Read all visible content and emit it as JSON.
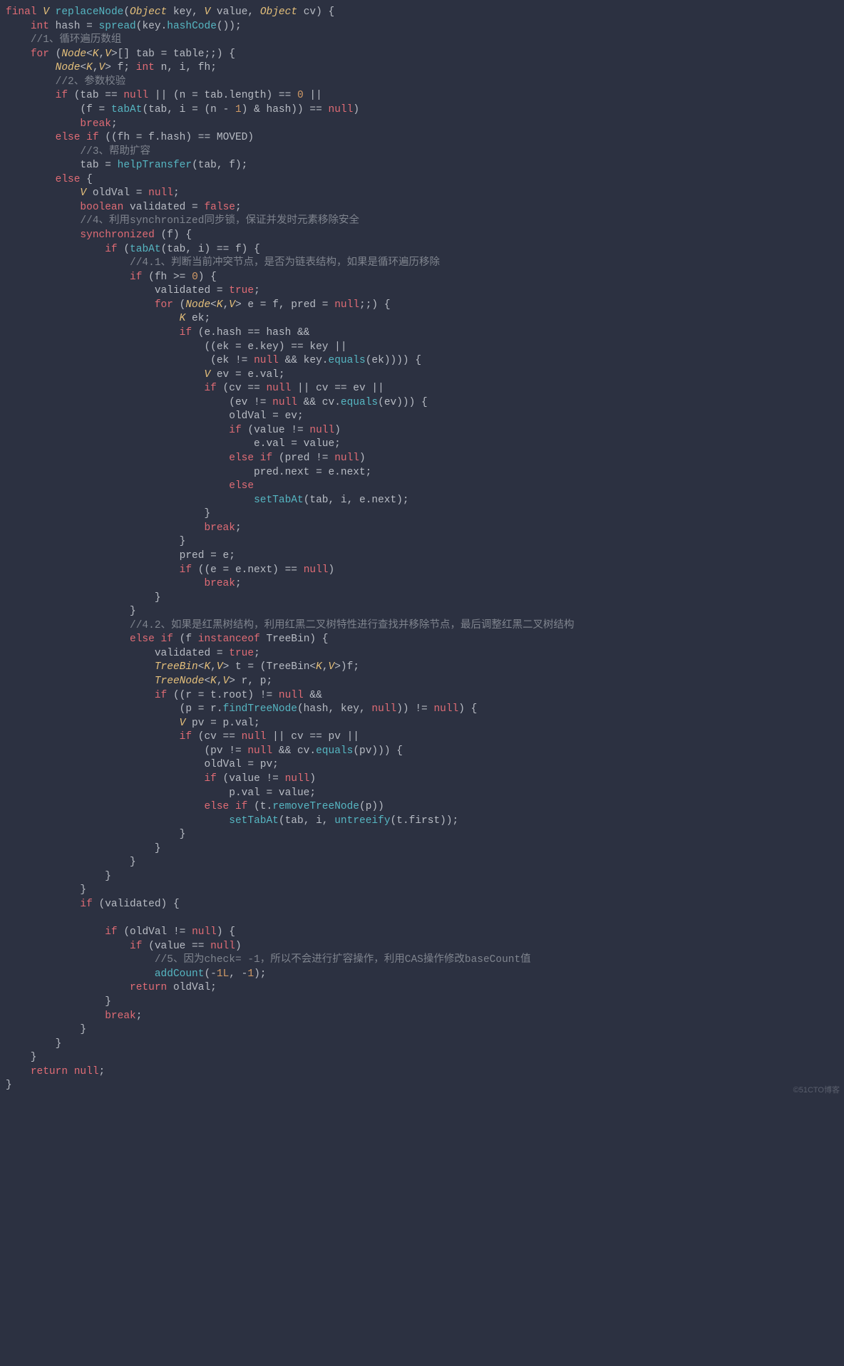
{
  "watermark": "©51CTO博客",
  "code": {
    "tokens": [
      [
        "kw",
        "final"
      ],
      [
        "p",
        " "
      ],
      [
        "type",
        "V"
      ],
      [
        "p",
        " "
      ],
      [
        "fn",
        "replaceNode"
      ],
      [
        "p",
        "("
      ],
      [
        "type",
        "Object"
      ],
      [
        "p",
        " key, "
      ],
      [
        "type",
        "V"
      ],
      [
        "p",
        " value, "
      ],
      [
        "type",
        "Object"
      ],
      [
        "p",
        " cv) {"
      ],
      [
        "nl"
      ],
      [
        "p",
        "    "
      ],
      [
        "kw",
        "int"
      ],
      [
        "p",
        " hash = "
      ],
      [
        "fn",
        "spread"
      ],
      [
        "p",
        "(key."
      ],
      [
        "fn",
        "hashCode"
      ],
      [
        "p",
        "());"
      ],
      [
        "nl"
      ],
      [
        "p",
        "    "
      ],
      [
        "cm",
        "//1、循环遍历数组"
      ],
      [
        "nl"
      ],
      [
        "p",
        "    "
      ],
      [
        "kw",
        "for"
      ],
      [
        "p",
        " ("
      ],
      [
        "type",
        "Node"
      ],
      [
        "p",
        "<"
      ],
      [
        "type",
        "K"
      ],
      [
        "p",
        ","
      ],
      [
        "type",
        "V"
      ],
      [
        "p",
        ">[] tab = table;;) {"
      ],
      [
        "nl"
      ],
      [
        "p",
        "        "
      ],
      [
        "type",
        "Node"
      ],
      [
        "p",
        "<"
      ],
      [
        "type",
        "K"
      ],
      [
        "p",
        ","
      ],
      [
        "type",
        "V"
      ],
      [
        "p",
        "> f; "
      ],
      [
        "kw",
        "int"
      ],
      [
        "p",
        " n, i, fh;"
      ],
      [
        "nl"
      ],
      [
        "p",
        "        "
      ],
      [
        "cm",
        "//2、参数校验"
      ],
      [
        "nl"
      ],
      [
        "p",
        "        "
      ],
      [
        "kw",
        "if"
      ],
      [
        "p",
        " (tab == "
      ],
      [
        "kw",
        "null"
      ],
      [
        "p",
        " || (n = tab.length) == "
      ],
      [
        "num",
        "0"
      ],
      [
        "p",
        " ||"
      ],
      [
        "nl"
      ],
      [
        "p",
        "            (f = "
      ],
      [
        "fn",
        "tabAt"
      ],
      [
        "p",
        "(tab, i = (n - "
      ],
      [
        "num",
        "1"
      ],
      [
        "p",
        ") & hash)) == "
      ],
      [
        "kw",
        "null"
      ],
      [
        "p",
        ")"
      ],
      [
        "nl"
      ],
      [
        "p",
        "            "
      ],
      [
        "kw",
        "break"
      ],
      [
        "p",
        ";"
      ],
      [
        "nl"
      ],
      [
        "p",
        "        "
      ],
      [
        "kw",
        "else if"
      ],
      [
        "p",
        " ((fh = f.hash) == MOVED)"
      ],
      [
        "nl"
      ],
      [
        "p",
        "            "
      ],
      [
        "cm",
        "//3、帮助扩容"
      ],
      [
        "nl"
      ],
      [
        "p",
        "            tab = "
      ],
      [
        "fn",
        "helpTransfer"
      ],
      [
        "p",
        "(tab, f);"
      ],
      [
        "nl"
      ],
      [
        "p",
        "        "
      ],
      [
        "kw",
        "else"
      ],
      [
        "p",
        " {"
      ],
      [
        "nl"
      ],
      [
        "p",
        "            "
      ],
      [
        "type",
        "V"
      ],
      [
        "p",
        " oldVal = "
      ],
      [
        "kw",
        "null"
      ],
      [
        "p",
        ";"
      ],
      [
        "nl"
      ],
      [
        "p",
        "            "
      ],
      [
        "kw",
        "boolean"
      ],
      [
        "p",
        " validated = "
      ],
      [
        "kw",
        "false"
      ],
      [
        "p",
        ";"
      ],
      [
        "nl"
      ],
      [
        "p",
        "            "
      ],
      [
        "cm",
        "//4、利用synchronized同步锁，保证并发时元素移除安全"
      ],
      [
        "nl"
      ],
      [
        "p",
        "            "
      ],
      [
        "kw",
        "synchronized"
      ],
      [
        "p",
        " (f) {"
      ],
      [
        "nl"
      ],
      [
        "p",
        "                "
      ],
      [
        "kw",
        "if"
      ],
      [
        "p",
        " ("
      ],
      [
        "fn",
        "tabAt"
      ],
      [
        "p",
        "(tab, i) == f) {"
      ],
      [
        "nl"
      ],
      [
        "p",
        "                    "
      ],
      [
        "cm",
        "//4.1、判断当前冲突节点，是否为链表结构，如果是循环遍历移除"
      ],
      [
        "nl"
      ],
      [
        "p",
        "                    "
      ],
      [
        "kw",
        "if"
      ],
      [
        "p",
        " (fh >= "
      ],
      [
        "num",
        "0"
      ],
      [
        "p",
        ") {"
      ],
      [
        "nl"
      ],
      [
        "p",
        "                        validated = "
      ],
      [
        "kw",
        "true"
      ],
      [
        "p",
        ";"
      ],
      [
        "nl"
      ],
      [
        "p",
        "                        "
      ],
      [
        "kw",
        "for"
      ],
      [
        "p",
        " ("
      ],
      [
        "type",
        "Node"
      ],
      [
        "p",
        "<"
      ],
      [
        "type",
        "K"
      ],
      [
        "p",
        ","
      ],
      [
        "type",
        "V"
      ],
      [
        "p",
        "> e = f, pred = "
      ],
      [
        "kw",
        "null"
      ],
      [
        "p",
        ";;) {"
      ],
      [
        "nl"
      ],
      [
        "p",
        "                            "
      ],
      [
        "type",
        "K"
      ],
      [
        "p",
        " ek;"
      ],
      [
        "nl"
      ],
      [
        "p",
        "                            "
      ],
      [
        "kw",
        "if"
      ],
      [
        "p",
        " (e.hash == hash &&"
      ],
      [
        "nl"
      ],
      [
        "p",
        "                                ((ek = e.key) == key ||"
      ],
      [
        "nl"
      ],
      [
        "p",
        "                                 (ek != "
      ],
      [
        "kw",
        "null"
      ],
      [
        "p",
        " && key."
      ],
      [
        "fn",
        "equals"
      ],
      [
        "p",
        "(ek)))) {"
      ],
      [
        "nl"
      ],
      [
        "p",
        "                                "
      ],
      [
        "type",
        "V"
      ],
      [
        "p",
        " ev = e.val;"
      ],
      [
        "nl"
      ],
      [
        "p",
        "                                "
      ],
      [
        "kw",
        "if"
      ],
      [
        "p",
        " (cv == "
      ],
      [
        "kw",
        "null"
      ],
      [
        "p",
        " || cv == ev ||"
      ],
      [
        "nl"
      ],
      [
        "p",
        "                                    (ev != "
      ],
      [
        "kw",
        "null"
      ],
      [
        "p",
        " && cv."
      ],
      [
        "fn",
        "equals"
      ],
      [
        "p",
        "(ev))) {"
      ],
      [
        "nl"
      ],
      [
        "p",
        "                                    oldVal = ev;"
      ],
      [
        "nl"
      ],
      [
        "p",
        "                                    "
      ],
      [
        "kw",
        "if"
      ],
      [
        "p",
        " (value != "
      ],
      [
        "kw",
        "null"
      ],
      [
        "p",
        ")"
      ],
      [
        "nl"
      ],
      [
        "p",
        "                                        e.val = value;"
      ],
      [
        "nl"
      ],
      [
        "p",
        "                                    "
      ],
      [
        "kw",
        "else if"
      ],
      [
        "p",
        " (pred != "
      ],
      [
        "kw",
        "null"
      ],
      [
        "p",
        ")"
      ],
      [
        "nl"
      ],
      [
        "p",
        "                                        pred.next = e.next;"
      ],
      [
        "nl"
      ],
      [
        "p",
        "                                    "
      ],
      [
        "kw",
        "else"
      ],
      [
        "nl"
      ],
      [
        "p",
        "                                        "
      ],
      [
        "fn",
        "setTabAt"
      ],
      [
        "p",
        "(tab, i, e.next);"
      ],
      [
        "nl"
      ],
      [
        "p",
        "                                }"
      ],
      [
        "nl"
      ],
      [
        "p",
        "                                "
      ],
      [
        "kw",
        "break"
      ],
      [
        "p",
        ";"
      ],
      [
        "nl"
      ],
      [
        "p",
        "                            }"
      ],
      [
        "nl"
      ],
      [
        "p",
        "                            pred = e;"
      ],
      [
        "nl"
      ],
      [
        "p",
        "                            "
      ],
      [
        "kw",
        "if"
      ],
      [
        "p",
        " ((e = e.next) == "
      ],
      [
        "kw",
        "null"
      ],
      [
        "p",
        ")"
      ],
      [
        "nl"
      ],
      [
        "p",
        "                                "
      ],
      [
        "kw",
        "break"
      ],
      [
        "p",
        ";"
      ],
      [
        "nl"
      ],
      [
        "p",
        "                        }"
      ],
      [
        "nl"
      ],
      [
        "p",
        "                    }"
      ],
      [
        "nl"
      ],
      [
        "p",
        "                    "
      ],
      [
        "cm",
        "//4.2、如果是红黑树结构，利用红黑二叉树特性进行查找并移除节点，最后调整红黑二叉树结构"
      ],
      [
        "nl"
      ],
      [
        "p",
        "                    "
      ],
      [
        "kw",
        "else if"
      ],
      [
        "p",
        " (f "
      ],
      [
        "kw",
        "instanceof"
      ],
      [
        "p",
        " TreeBin) {"
      ],
      [
        "nl"
      ],
      [
        "p",
        "                        validated = "
      ],
      [
        "kw",
        "true"
      ],
      [
        "p",
        ";"
      ],
      [
        "nl"
      ],
      [
        "p",
        "                        "
      ],
      [
        "type",
        "TreeBin"
      ],
      [
        "p",
        "<"
      ],
      [
        "type",
        "K"
      ],
      [
        "p",
        ","
      ],
      [
        "type",
        "V"
      ],
      [
        "p",
        "> t = (TreeBin<"
      ],
      [
        "type",
        "K"
      ],
      [
        "p",
        ","
      ],
      [
        "type",
        "V"
      ],
      [
        "p",
        ">)f;"
      ],
      [
        "nl"
      ],
      [
        "p",
        "                        "
      ],
      [
        "type",
        "TreeNode"
      ],
      [
        "p",
        "<"
      ],
      [
        "type",
        "K"
      ],
      [
        "p",
        ","
      ],
      [
        "type",
        "V"
      ],
      [
        "p",
        "> r, p;"
      ],
      [
        "nl"
      ],
      [
        "p",
        "                        "
      ],
      [
        "kw",
        "if"
      ],
      [
        "p",
        " ((r = t.root) != "
      ],
      [
        "kw",
        "null"
      ],
      [
        "p",
        " &&"
      ],
      [
        "nl"
      ],
      [
        "p",
        "                            (p = r."
      ],
      [
        "fn",
        "findTreeNode"
      ],
      [
        "p",
        "(hash, key, "
      ],
      [
        "kw",
        "null"
      ],
      [
        "p",
        ")) != "
      ],
      [
        "kw",
        "null"
      ],
      [
        "p",
        ") {"
      ],
      [
        "nl"
      ],
      [
        "p",
        "                            "
      ],
      [
        "type",
        "V"
      ],
      [
        "p",
        " pv = p.val;"
      ],
      [
        "nl"
      ],
      [
        "p",
        "                            "
      ],
      [
        "kw",
        "if"
      ],
      [
        "p",
        " (cv == "
      ],
      [
        "kw",
        "null"
      ],
      [
        "p",
        " || cv == pv ||"
      ],
      [
        "nl"
      ],
      [
        "p",
        "                                (pv != "
      ],
      [
        "kw",
        "null"
      ],
      [
        "p",
        " && cv."
      ],
      [
        "fn",
        "equals"
      ],
      [
        "p",
        "(pv))) {"
      ],
      [
        "nl"
      ],
      [
        "p",
        "                                oldVal = pv;"
      ],
      [
        "nl"
      ],
      [
        "p",
        "                                "
      ],
      [
        "kw",
        "if"
      ],
      [
        "p",
        " (value != "
      ],
      [
        "kw",
        "null"
      ],
      [
        "p",
        ")"
      ],
      [
        "nl"
      ],
      [
        "p",
        "                                    p.val = value;"
      ],
      [
        "nl"
      ],
      [
        "p",
        "                                "
      ],
      [
        "kw",
        "else if"
      ],
      [
        "p",
        " (t."
      ],
      [
        "fn",
        "removeTreeNode"
      ],
      [
        "p",
        "(p))"
      ],
      [
        "nl"
      ],
      [
        "p",
        "                                    "
      ],
      [
        "fn",
        "setTabAt"
      ],
      [
        "p",
        "(tab, i, "
      ],
      [
        "fn",
        "untreeify"
      ],
      [
        "p",
        "(t.first));"
      ],
      [
        "nl"
      ],
      [
        "p",
        "                            }"
      ],
      [
        "nl"
      ],
      [
        "p",
        "                        }"
      ],
      [
        "nl"
      ],
      [
        "p",
        "                    }"
      ],
      [
        "nl"
      ],
      [
        "p",
        "                }"
      ],
      [
        "nl"
      ],
      [
        "p",
        "            }"
      ],
      [
        "nl"
      ],
      [
        "p",
        "            "
      ],
      [
        "kw",
        "if"
      ],
      [
        "p",
        " (validated) {"
      ],
      [
        "nl"
      ],
      [
        "nl"
      ],
      [
        "p",
        "                "
      ],
      [
        "kw",
        "if"
      ],
      [
        "p",
        " (oldVal != "
      ],
      [
        "kw",
        "null"
      ],
      [
        "p",
        ") {"
      ],
      [
        "nl"
      ],
      [
        "p",
        "                    "
      ],
      [
        "kw",
        "if"
      ],
      [
        "p",
        " (value == "
      ],
      [
        "kw",
        "null"
      ],
      [
        "p",
        ")"
      ],
      [
        "nl"
      ],
      [
        "p",
        "                        "
      ],
      [
        "cm",
        "//5、因为check= -1，所以不会进行扩容操作，利用CAS操作修改baseCount值"
      ],
      [
        "nl"
      ],
      [
        "p",
        "                        "
      ],
      [
        "fn",
        "addCount"
      ],
      [
        "p",
        "(-"
      ],
      [
        "num",
        "1L"
      ],
      [
        "p",
        ", -"
      ],
      [
        "num",
        "1"
      ],
      [
        "p",
        ");"
      ],
      [
        "nl"
      ],
      [
        "p",
        "                    "
      ],
      [
        "kw",
        "return"
      ],
      [
        "p",
        " oldVal;"
      ],
      [
        "nl"
      ],
      [
        "p",
        "                }"
      ],
      [
        "nl"
      ],
      [
        "p",
        "                "
      ],
      [
        "kw",
        "break"
      ],
      [
        "p",
        ";"
      ],
      [
        "nl"
      ],
      [
        "p",
        "            }"
      ],
      [
        "nl"
      ],
      [
        "p",
        "        }"
      ],
      [
        "nl"
      ],
      [
        "p",
        "    }"
      ],
      [
        "nl"
      ],
      [
        "p",
        "    "
      ],
      [
        "kw",
        "return"
      ],
      [
        "p",
        " "
      ],
      [
        "kw",
        "null"
      ],
      [
        "p",
        ";"
      ],
      [
        "nl"
      ],
      [
        "p",
        "}"
      ]
    ]
  }
}
